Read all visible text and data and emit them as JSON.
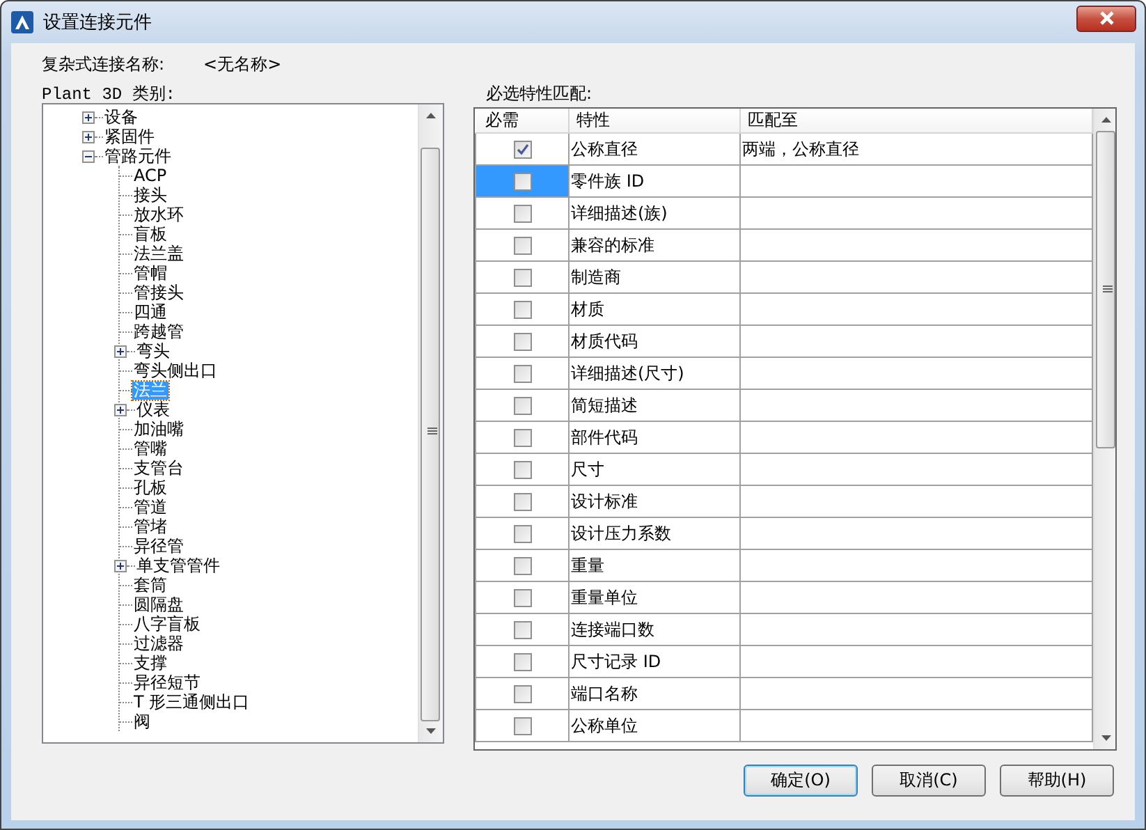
{
  "window": {
    "title": "设置连接元件"
  },
  "connection_name": {
    "label": "复杂式连接名称:",
    "value": "<无名称>"
  },
  "category_label": "Plant 3D 类别:",
  "tree": [
    {
      "label": "设备",
      "expanded": false,
      "selected": false
    },
    {
      "label": "紧固件",
      "expanded": false,
      "selected": false
    },
    {
      "label": "管路元件",
      "expanded": true,
      "selected": false,
      "children": [
        {
          "label": "ACP",
          "selected": false
        },
        {
          "label": "接头",
          "selected": false
        },
        {
          "label": "放水环",
          "selected": false
        },
        {
          "label": "盲板",
          "selected": false
        },
        {
          "label": "法兰盖",
          "selected": false
        },
        {
          "label": "管帽",
          "selected": false
        },
        {
          "label": "管接头",
          "selected": false
        },
        {
          "label": "四通",
          "selected": false
        },
        {
          "label": "跨越管",
          "selected": false
        },
        {
          "label": "弯头",
          "expanded": false,
          "selected": false
        },
        {
          "label": "弯头侧出口",
          "selected": false
        },
        {
          "label": "法兰",
          "selected": true
        },
        {
          "label": "仪表",
          "expanded": false,
          "selected": false
        },
        {
          "label": "加油嘴",
          "selected": false
        },
        {
          "label": "管嘴",
          "selected": false
        },
        {
          "label": "支管台",
          "selected": false
        },
        {
          "label": "孔板",
          "selected": false
        },
        {
          "label": "管道",
          "selected": false
        },
        {
          "label": "管堵",
          "selected": false
        },
        {
          "label": "异径管",
          "selected": false
        },
        {
          "label": "单支管管件",
          "expanded": false,
          "selected": false
        },
        {
          "label": "套筒",
          "selected": false
        },
        {
          "label": "圆隔盘",
          "selected": false
        },
        {
          "label": "八字盲板",
          "selected": false
        },
        {
          "label": "过滤器",
          "selected": false
        },
        {
          "label": "支撑",
          "selected": false
        },
        {
          "label": "异径短节",
          "selected": false
        },
        {
          "label": "T 形三通侧出口",
          "selected": false
        },
        {
          "label": "阀",
          "selected": false
        }
      ]
    }
  ],
  "match_label": "必选特性匹配:",
  "table": {
    "columns": [
      "必需",
      "特性",
      "匹配至"
    ],
    "rows": [
      {
        "required": true,
        "property": "公称直径",
        "match_to": "两端，公称直径",
        "selected": false
      },
      {
        "required": false,
        "property": "零件族 ID",
        "selected": true
      },
      {
        "required": false,
        "property": "详细描述(族)",
        "selected": false
      },
      {
        "required": false,
        "property": "兼容的标准",
        "selected": false
      },
      {
        "required": false,
        "property": "制造商",
        "selected": false
      },
      {
        "required": false,
        "property": "材质",
        "selected": false
      },
      {
        "required": false,
        "property": "材质代码",
        "selected": false
      },
      {
        "required": false,
        "property": "详细描述(尺寸)",
        "selected": false
      },
      {
        "required": false,
        "property": "简短描述",
        "selected": false
      },
      {
        "required": false,
        "property": "部件代码",
        "selected": false
      },
      {
        "required": false,
        "property": "尺寸",
        "selected": false
      },
      {
        "required": false,
        "property": "设计标准",
        "selected": false
      },
      {
        "required": false,
        "property": "设计压力系数",
        "selected": false
      },
      {
        "required": false,
        "property": "重量",
        "selected": false
      },
      {
        "required": false,
        "property": "重量单位",
        "selected": false
      },
      {
        "required": false,
        "property": "连接端口数",
        "selected": false
      },
      {
        "required": false,
        "property": "尺寸记录 ID",
        "selected": false
      },
      {
        "required": false,
        "property": "端口名称",
        "selected": false
      },
      {
        "required": false,
        "property": "公称单位",
        "selected": false
      }
    ]
  },
  "buttons": [
    {
      "label": "确定(O)",
      "default": true
    },
    {
      "label": "取消(C)",
      "default": false
    },
    {
      "label": "帮助(H)",
      "default": false
    }
  ]
}
